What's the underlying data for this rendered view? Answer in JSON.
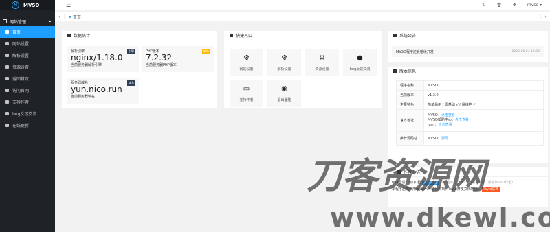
{
  "app": {
    "brand": "MVSO",
    "brand_mark": "M"
  },
  "sidebar": {
    "group_label": "网站管理",
    "items": [
      {
        "label": "首页",
        "active": true
      },
      {
        "label": "网站设置"
      },
      {
        "label": "解析设置"
      },
      {
        "label": "资源设置"
      },
      {
        "label": "返回首页"
      },
      {
        "label": "访问官网"
      },
      {
        "label": "支持作者"
      },
      {
        "label": "bug反馈交流"
      },
      {
        "label": "在线更新"
      }
    ]
  },
  "topbar": {
    "user": "mvso",
    "user_caret": "▾"
  },
  "tabs": {
    "active": "首页",
    "left": "‹",
    "right": "›"
  },
  "stats_card": {
    "title": "数据统计",
    "items": [
      {
        "label": "解析引擎",
        "value": "nginx/1.18.0",
        "sub": "当前服务器解析引擎",
        "badge": "引擎",
        "badge_color": "#2f4056"
      },
      {
        "label": "PHP版本",
        "value": "7.2.32",
        "sub": "当前服务器PHP版本",
        "badge": "版本",
        "badge_color": "#ffb800"
      },
      {
        "label": "服务器域名",
        "value": "yun.nico.run",
        "sub": "当前服务器域名",
        "badge": "域名",
        "badge_color": "#2f4056"
      }
    ]
  },
  "quick_card": {
    "title": "快捷入口",
    "items": [
      {
        "label": "网站设置",
        "icon": "gear-icon",
        "glyph": "⚙"
      },
      {
        "label": "解析设置",
        "icon": "gear-icon",
        "glyph": "⚙"
      },
      {
        "label": "资源设置",
        "icon": "gear-icon",
        "glyph": "⚙"
      },
      {
        "label": "bug反馈交流",
        "icon": "qq-icon",
        "glyph": "●"
      },
      {
        "label": "支持作者",
        "icon": "card-icon",
        "glyph": "▭"
      },
      {
        "label": "退出登陆",
        "icon": "target-icon",
        "glyph": "◉"
      }
    ]
  },
  "notice_card": {
    "title": "系统公告",
    "text": "MVSO程序还会继续开发",
    "date": "2020-08-24 12:00"
  },
  "version_card": {
    "title": "版本信息",
    "rows": [
      {
        "key": "程序名称",
        "value": "MVSO"
      },
      {
        "key": "当前版本",
        "value": "v1.3.0"
      },
      {
        "key": "主要特色",
        "value": "简单易用 / 零基础 √ / 易维护 √"
      },
      {
        "key": "官方地址",
        "lines": [
          {
            "prefix": "MVSO：",
            "link": "点击查看"
          },
          {
            "prefix": "MVSO帮助中心：",
            "link": "点击查看"
          },
          {
            "prefix": "Ican：",
            "link": "点击查看"
          }
        ]
      },
      {
        "key": "推荐源码站",
        "value_prefix": "MVSO：",
        "link": "源码"
      }
    ]
  },
  "author_card": {
    "title": "作者心语",
    "line1_prefix": "bug反馈：加QQ群",
    "line1_tag": "点我加群",
    "line1_suffix": "（本程序基于MVSO进行开发，感谢MVSO作者）",
    "line2": "本程序后端采用layuimini进行实现。layui开发文档地址：",
    "line2_tag": "layui文档"
  },
  "watermark": {
    "line1": "刀客资源网",
    "line2": "www.dkewl.com"
  }
}
